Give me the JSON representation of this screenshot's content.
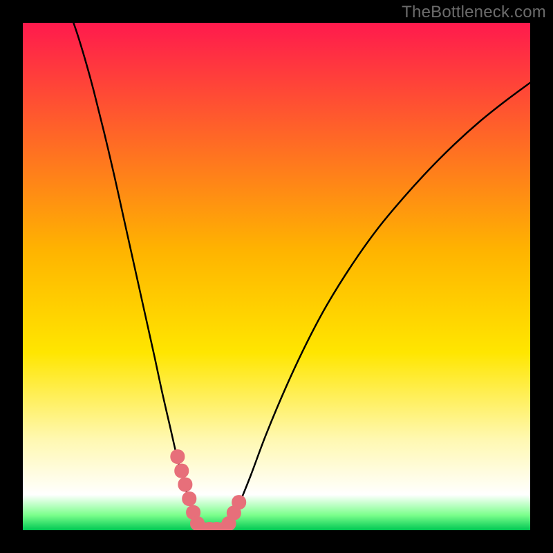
{
  "watermark": "TheBottleneck.com",
  "chart_data": {
    "type": "line",
    "title": "",
    "xlabel": "",
    "ylabel": "",
    "xlim": [
      0,
      100
    ],
    "ylim": [
      0,
      100
    ],
    "gradient_stops": [
      {
        "offset": 0.0,
        "color": "#ff1a4d"
      },
      {
        "offset": 0.45,
        "color": "#ffb400"
      },
      {
        "offset": 0.65,
        "color": "#ffe600"
      },
      {
        "offset": 0.82,
        "color": "#fff8b0"
      },
      {
        "offset": 0.93,
        "color": "#ffffff"
      },
      {
        "offset": 0.97,
        "color": "#7cff8c"
      },
      {
        "offset": 1.0,
        "color": "#00c853"
      }
    ],
    "series": [
      {
        "name": "left-branch",
        "x": [
          10,
          11,
          12.5,
          14,
          16,
          18,
          20,
          22,
          24,
          26,
          27.5,
          29,
          30.5,
          32,
          33.5,
          34,
          35
        ],
        "y": [
          100,
          97,
          92,
          86.5,
          78.5,
          70,
          61,
          52,
          43,
          34,
          27,
          20.5,
          14,
          8.5,
          3.5,
          1.8,
          0.3
        ]
      },
      {
        "name": "right-branch",
        "x": [
          40,
          41.5,
          43,
          45,
          48,
          52,
          56,
          60,
          65,
          70,
          75,
          80,
          85,
          90,
          95,
          100
        ],
        "y": [
          0.3,
          2.5,
          6,
          11,
          19,
          28.5,
          37,
          44.5,
          52.5,
          59.5,
          65.5,
          71,
          76,
          80.5,
          84.5,
          88.2
        ]
      }
    ],
    "markers": {
      "name": "highlight-band",
      "color": "#e76f7a",
      "points": [
        {
          "x": 30.5,
          "y": 14.5
        },
        {
          "x": 31.3,
          "y": 11.7
        },
        {
          "x": 32.0,
          "y": 9.0
        },
        {
          "x": 32.8,
          "y": 6.2
        },
        {
          "x": 33.6,
          "y": 3.5
        },
        {
          "x": 34.4,
          "y": 1.3
        },
        {
          "x": 35.4,
          "y": 0.2
        },
        {
          "x": 36.8,
          "y": 0.2
        },
        {
          "x": 38.2,
          "y": 0.2
        },
        {
          "x": 39.6,
          "y": 0.2
        },
        {
          "x": 40.6,
          "y": 1.3
        },
        {
          "x": 41.6,
          "y": 3.4
        },
        {
          "x": 42.6,
          "y": 5.5
        }
      ]
    }
  }
}
